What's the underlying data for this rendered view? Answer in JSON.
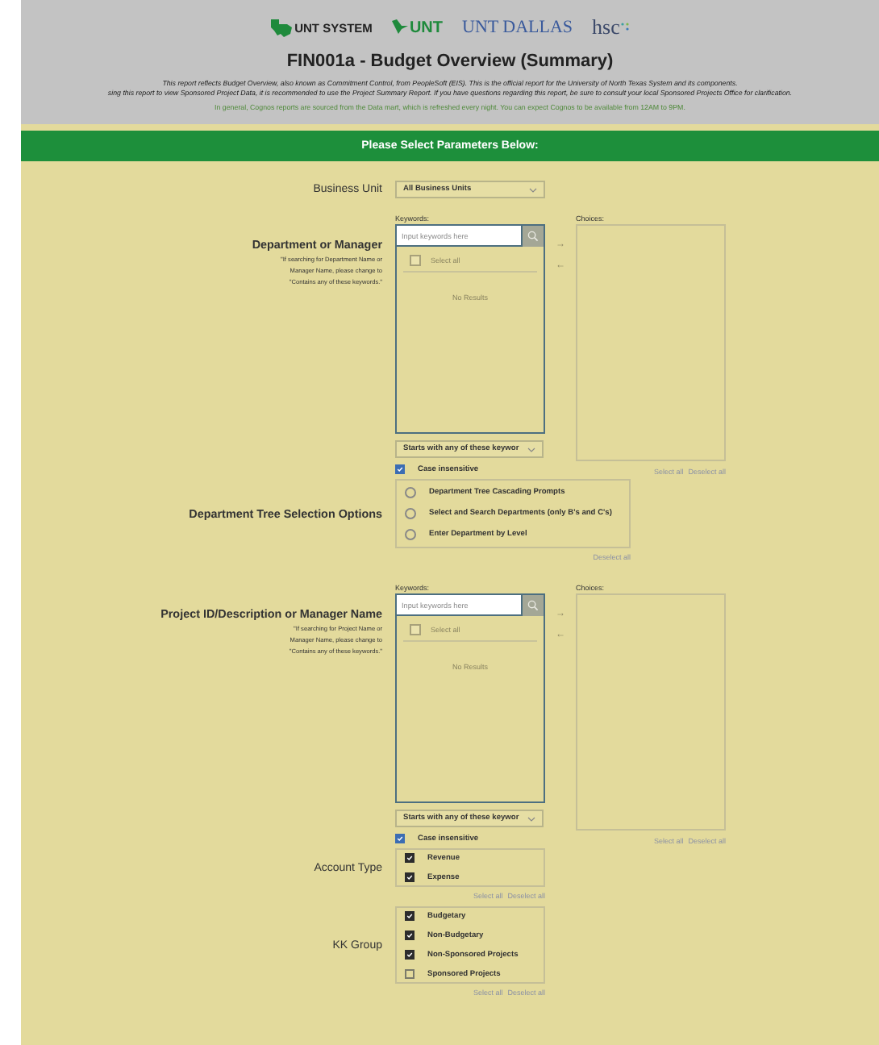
{
  "header": {
    "logos": [
      {
        "kind": "system",
        "text": "UNT SYSTEM"
      },
      {
        "kind": "unt",
        "text": "UNT"
      },
      {
        "kind": "dallas",
        "text": "UNT DALLAS"
      },
      {
        "kind": "hsc",
        "text": "hsc"
      }
    ],
    "title": "FIN001a - Budget Overview (Summary)",
    "notes": [
      "This report reflects Budget Overview, also known as Commitment Control, from PeopleSoft (EIS). This is the official report for the University of North Texas System and its components.",
      "sing this report to view Sponsored Project Data, it is recommended to use the Project Summary Report. If you have questions regarding this report, be sure to consult your local Sponsored Projects Office for clarification."
    ],
    "notice": "In general, Cognos reports are sourced from the Data mart, which is refreshed every night. You can expect Cognos to be available from 12AM to 9PM."
  },
  "banner": "Please Select Parameters Below:",
  "business_unit": {
    "label": "Business Unit",
    "value": "All Business Units"
  },
  "choosers": [
    {
      "label": "Department or Manager",
      "note": [
        "\"If searching for Department Name or",
        "Manager Name, please change to",
        "\"Contains any of these keywords.\""
      ],
      "keywords_label": "Keywords:",
      "placeholder": "Input keywords here",
      "select_all_item": "Select all",
      "select_all_checked": false,
      "no_results": "No Results",
      "arrows": [
        "→",
        "←"
      ],
      "choices_label": "Choices:",
      "match_mode": "Starts with any of these keywor",
      "case_insensitive": {
        "label": "Case insensitive",
        "checked": true
      },
      "select_all": "Select all",
      "deselect_all": "Deselect all"
    },
    {
      "label": "Project ID/Description or Manager Name",
      "note": [
        "\"If searching for Project Name or",
        "Manager Name, please change to",
        "\"Contains any of these keywords.\""
      ],
      "keywords_label": "Keywords:",
      "placeholder": "Input keywords here",
      "select_all_item": "Select all",
      "select_all_checked": false,
      "no_results": "No Results",
      "arrows": [
        "→",
        "←"
      ],
      "choices_label": "Choices:",
      "match_mode": "Starts with any of these keywor",
      "case_insensitive": {
        "label": "Case insensitive",
        "checked": true
      },
      "select_all": "Select all",
      "deselect_all": "Deselect all"
    }
  ],
  "tree_options": {
    "label": "Department Tree Selection Options",
    "options": [
      {
        "label": "Department Tree Cascading Prompts",
        "selected": false
      },
      {
        "label": "Select and Search Departments (only B's and C's)",
        "selected": false
      },
      {
        "label": "Enter Department by Level",
        "selected": false
      }
    ],
    "deselect_all": "Deselect all"
  },
  "account_type": {
    "label": "Account Type",
    "items": [
      {
        "label": "Revenue",
        "checked": true
      },
      {
        "label": "Expense",
        "checked": true
      }
    ],
    "select_all": "Select all",
    "deselect_all": "Deselect all"
  },
  "kk_group": {
    "label": "KK Group",
    "items": [
      {
        "label": "Budgetary",
        "checked": true
      },
      {
        "label": "Non-Budgetary",
        "checked": true
      },
      {
        "label": "Non-Sponsored Projects",
        "checked": true
      },
      {
        "label": "Sponsored Projects",
        "checked": false
      }
    ],
    "select_all": "Select all",
    "deselect_all": "Deselect all"
  }
}
